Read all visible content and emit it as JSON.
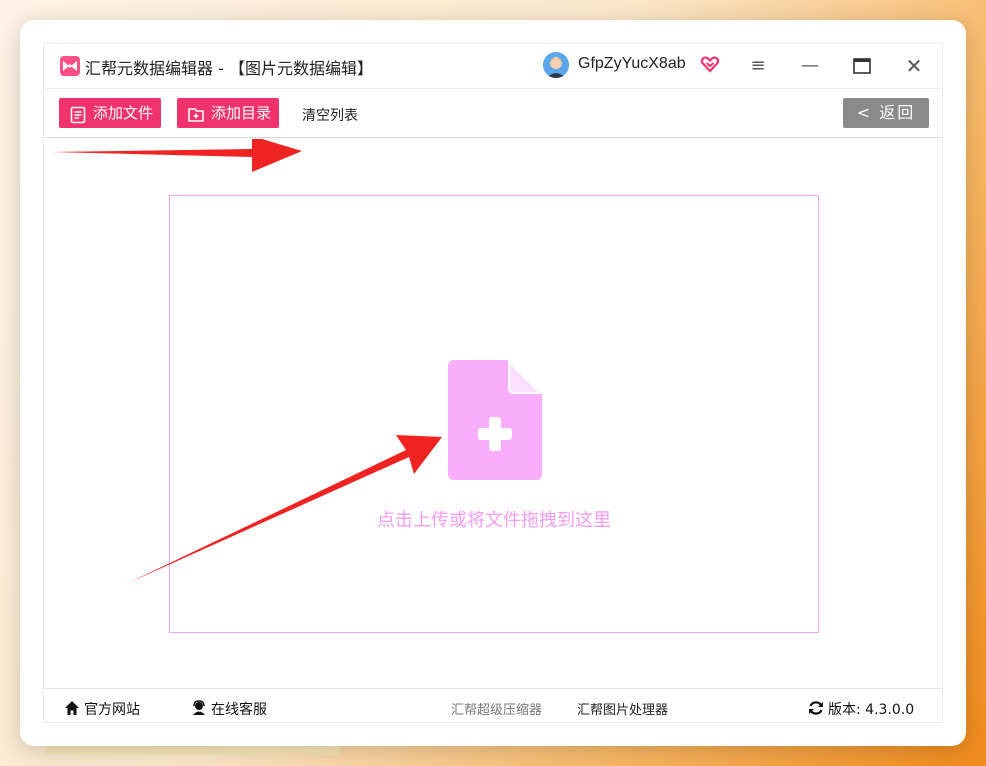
{
  "app": {
    "title": "汇帮元数据编辑器 - 【图片元数据编辑】",
    "logo_icon": "bowtie-logo-icon",
    "accent_color": "#f0336d"
  },
  "user": {
    "name": "GfpZyYucX8ab",
    "avatar_icon": "user-avatar-icon",
    "vip_icon": "heart-badge-icon"
  },
  "window_controls": {
    "menu": "≡",
    "minimize": "—",
    "maximize": "☐",
    "close": "✕"
  },
  "toolbar": {
    "add_file_label": "添加文件",
    "add_dir_label": "添加目录",
    "clear_label": "清空列表",
    "back_label": "< 返回"
  },
  "drop_zone": {
    "hint": "点击上传或将文件拖拽到这里",
    "icon": "file-plus-icon",
    "color": "#f79cf2"
  },
  "statusbar": {
    "home_label": "官方网站",
    "service_label": "在线客服",
    "compress_link": "汇帮超级压缩器",
    "image_link": "汇帮图片处理器",
    "version_label": "版本: 4.3.0.0"
  }
}
